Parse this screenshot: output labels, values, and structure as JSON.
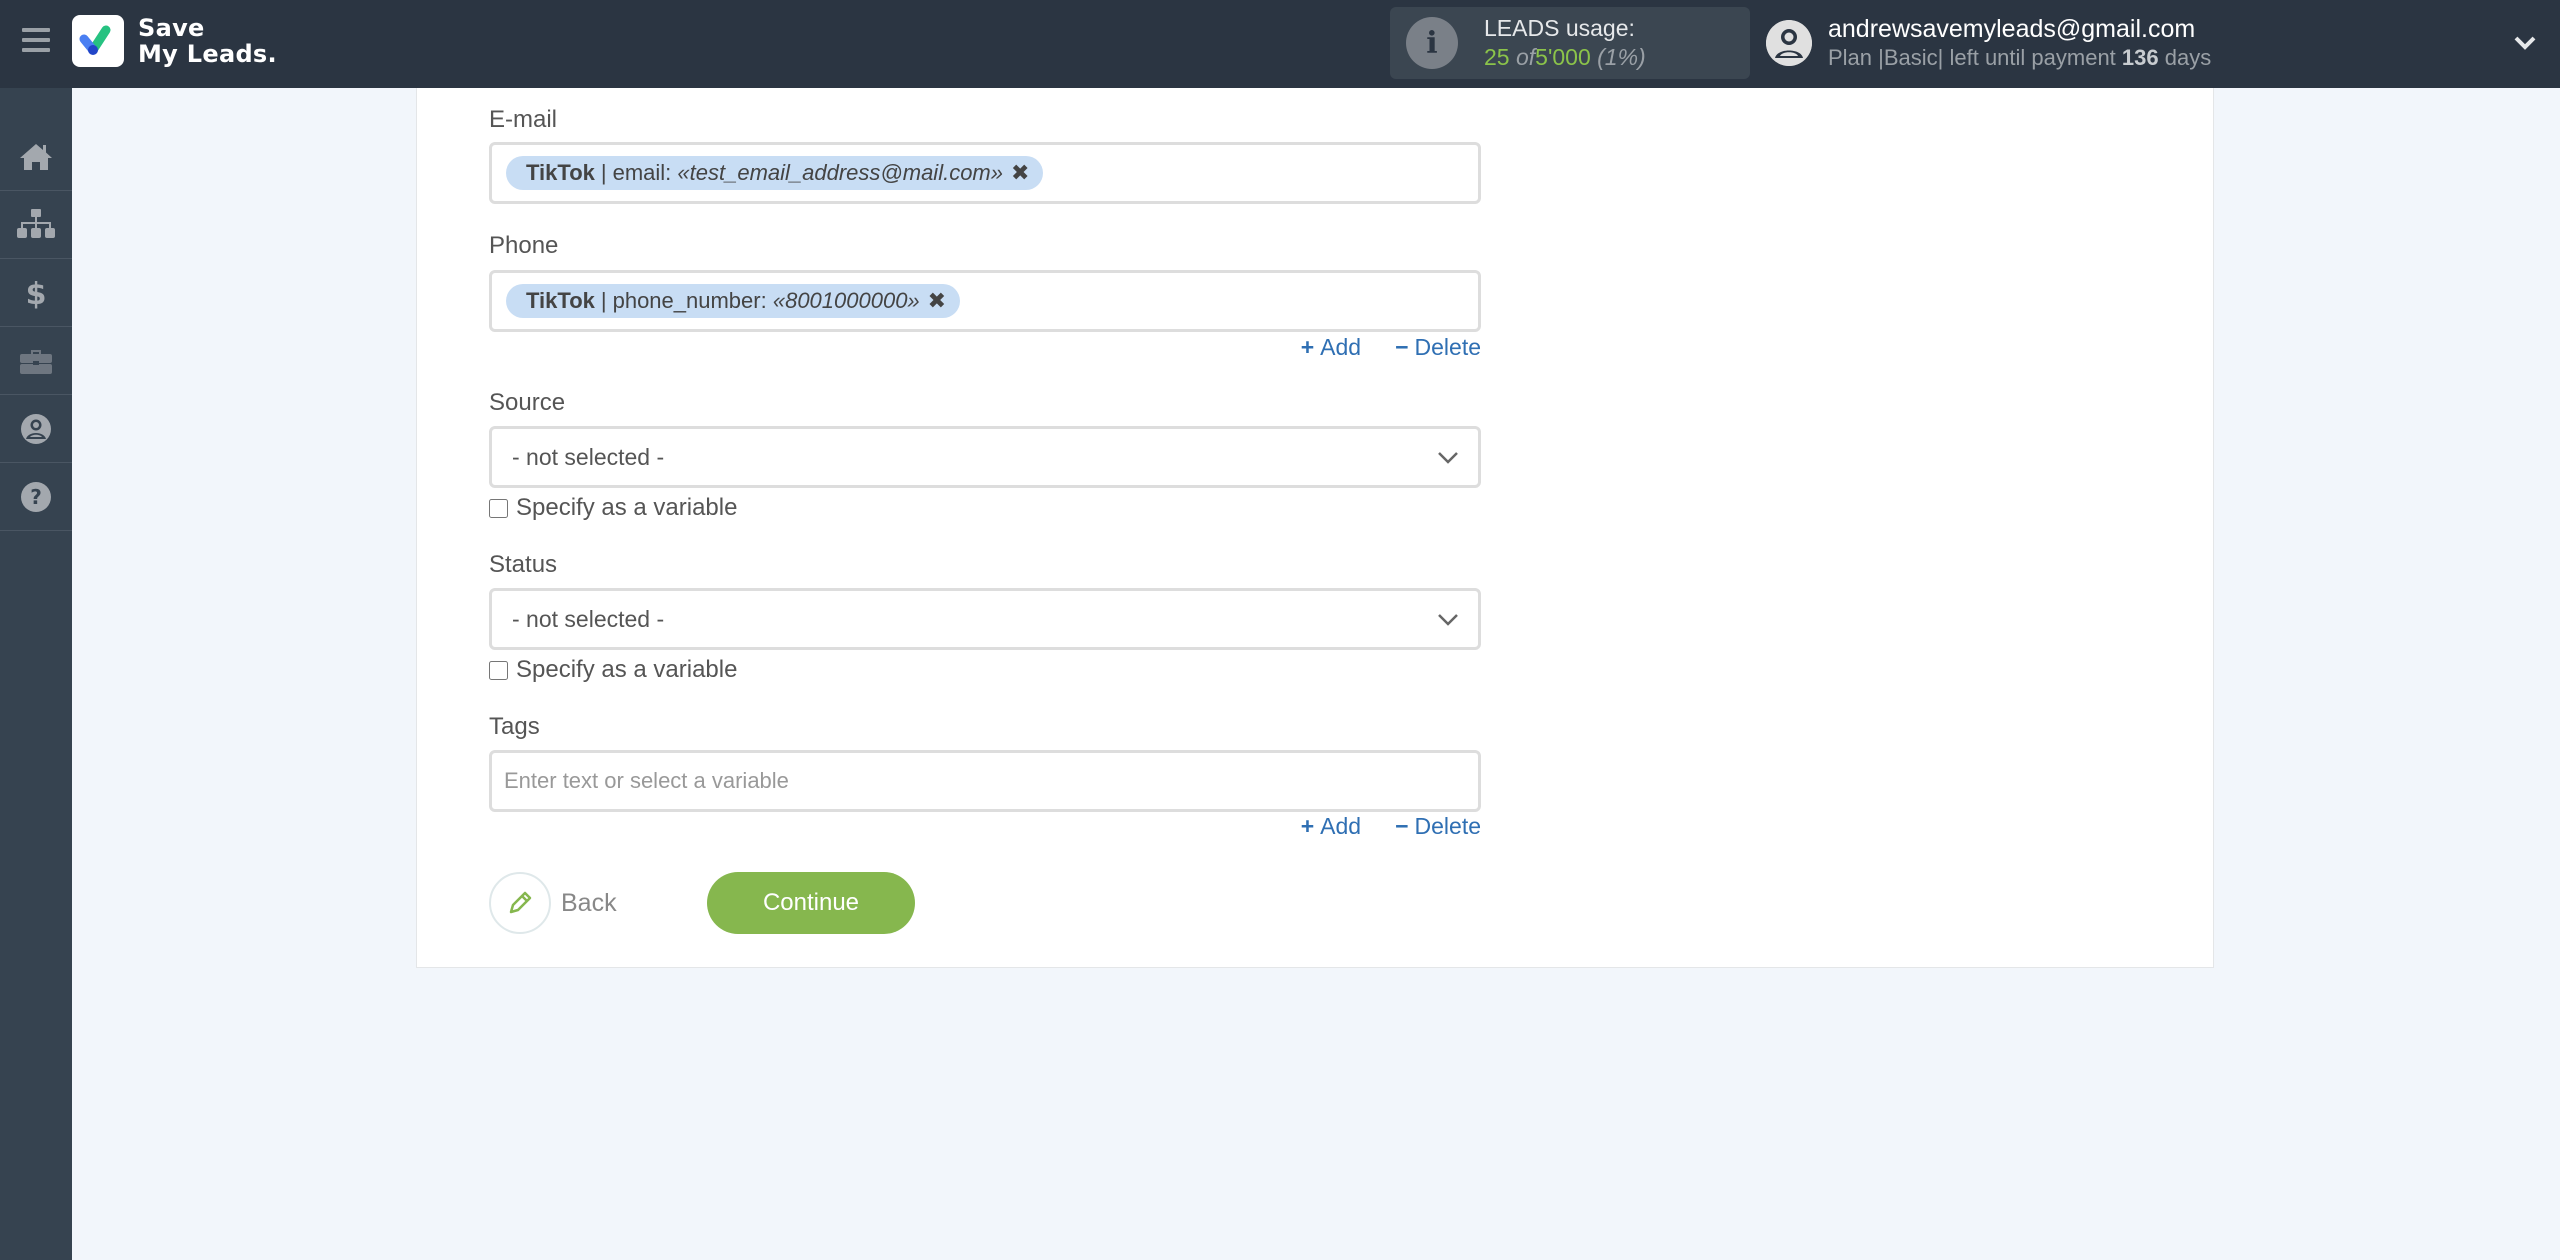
{
  "app": {
    "logo_line1": "Save",
    "logo_line2": "My Leads.",
    "menu_icon": "hamburger-icon"
  },
  "usage": {
    "title": "LEADS usage:",
    "used": "25",
    "of_label": "of",
    "limit": "5'000",
    "percent": "(1%)",
    "icon": "info-icon"
  },
  "user": {
    "email": "andrewsavemyleads@gmail.com",
    "plan_prefix": "Plan |Basic| left until payment",
    "days": "136",
    "days_suffix": "days",
    "icon": "user-avatar-icon"
  },
  "sidebar": {
    "items": [
      {
        "name": "home",
        "icon": "home-icon"
      },
      {
        "name": "connections",
        "icon": "sitemap-icon"
      },
      {
        "name": "billing",
        "icon": "dollar-icon"
      },
      {
        "name": "tools",
        "icon": "briefcase-icon"
      },
      {
        "name": "account",
        "icon": "user-circle-icon"
      },
      {
        "name": "help",
        "icon": "question-circle-icon"
      }
    ]
  },
  "form": {
    "email": {
      "label": "E-mail",
      "chip_source": "TikTok",
      "chip_sep": "|",
      "chip_field": "email:",
      "chip_value": "«test_email_address@mail.com»",
      "chip_remove": "✖"
    },
    "phone": {
      "label": "Phone",
      "chip_source": "TikTok",
      "chip_sep": "|",
      "chip_field": "phone_number:",
      "chip_value": "«8001000000»",
      "chip_remove": "✖",
      "add_label": "Add",
      "delete_label": "Delete"
    },
    "source": {
      "label": "Source",
      "selected": "- not selected -",
      "checkbox_label": "Specify as a variable",
      "checked": false
    },
    "status": {
      "label": "Status",
      "selected": "- not selected -",
      "checkbox_label": "Specify as a variable",
      "checked": false
    },
    "tags": {
      "label": "Tags",
      "placeholder": "Enter text or select a variable",
      "value": "",
      "add_label": "Add",
      "delete_label": "Delete"
    },
    "back_label": "Back",
    "continue_label": "Continue"
  },
  "colors": {
    "topbar": "#2b3542",
    "sidebar": "#364350",
    "accent_green": "#86b74e",
    "link_blue": "#2f6fb3",
    "chip_bg": "#c8ddf4"
  }
}
